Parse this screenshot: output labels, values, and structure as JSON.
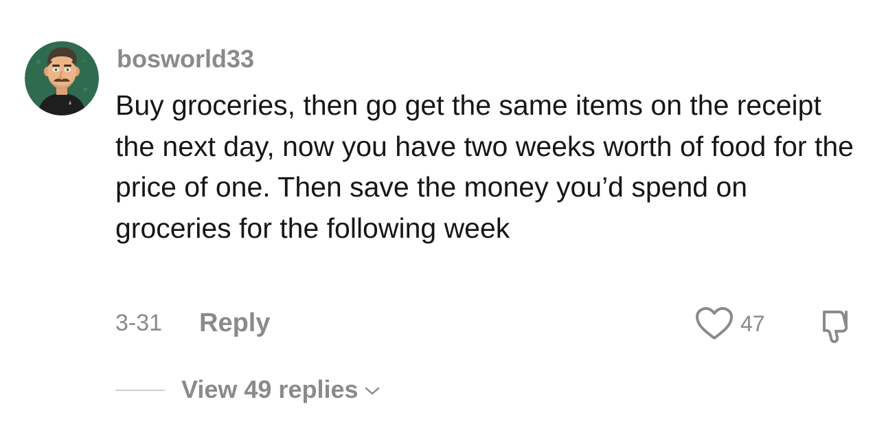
{
  "comment": {
    "username": "bosworld33",
    "text": "Buy groceries, then go get the same items on the receipt the next day, now you have two weeks worth of food for the price of one. Then save the money you’d spend on groceries for the following week",
    "date": "3-31",
    "reply_label": "Reply",
    "like_count": "47",
    "view_replies_label": "View 49 replies"
  },
  "icons": {
    "avatar": "avatar-cartoon-man",
    "like": "heart-outline-icon",
    "dislike": "thumbs-down-outline-icon",
    "expand": "chevron-down-icon"
  },
  "colors": {
    "background": "#ffffff",
    "text_primary": "#161616",
    "text_secondary": "#8a8a8a",
    "avatar_background": "#2f6b4f"
  }
}
